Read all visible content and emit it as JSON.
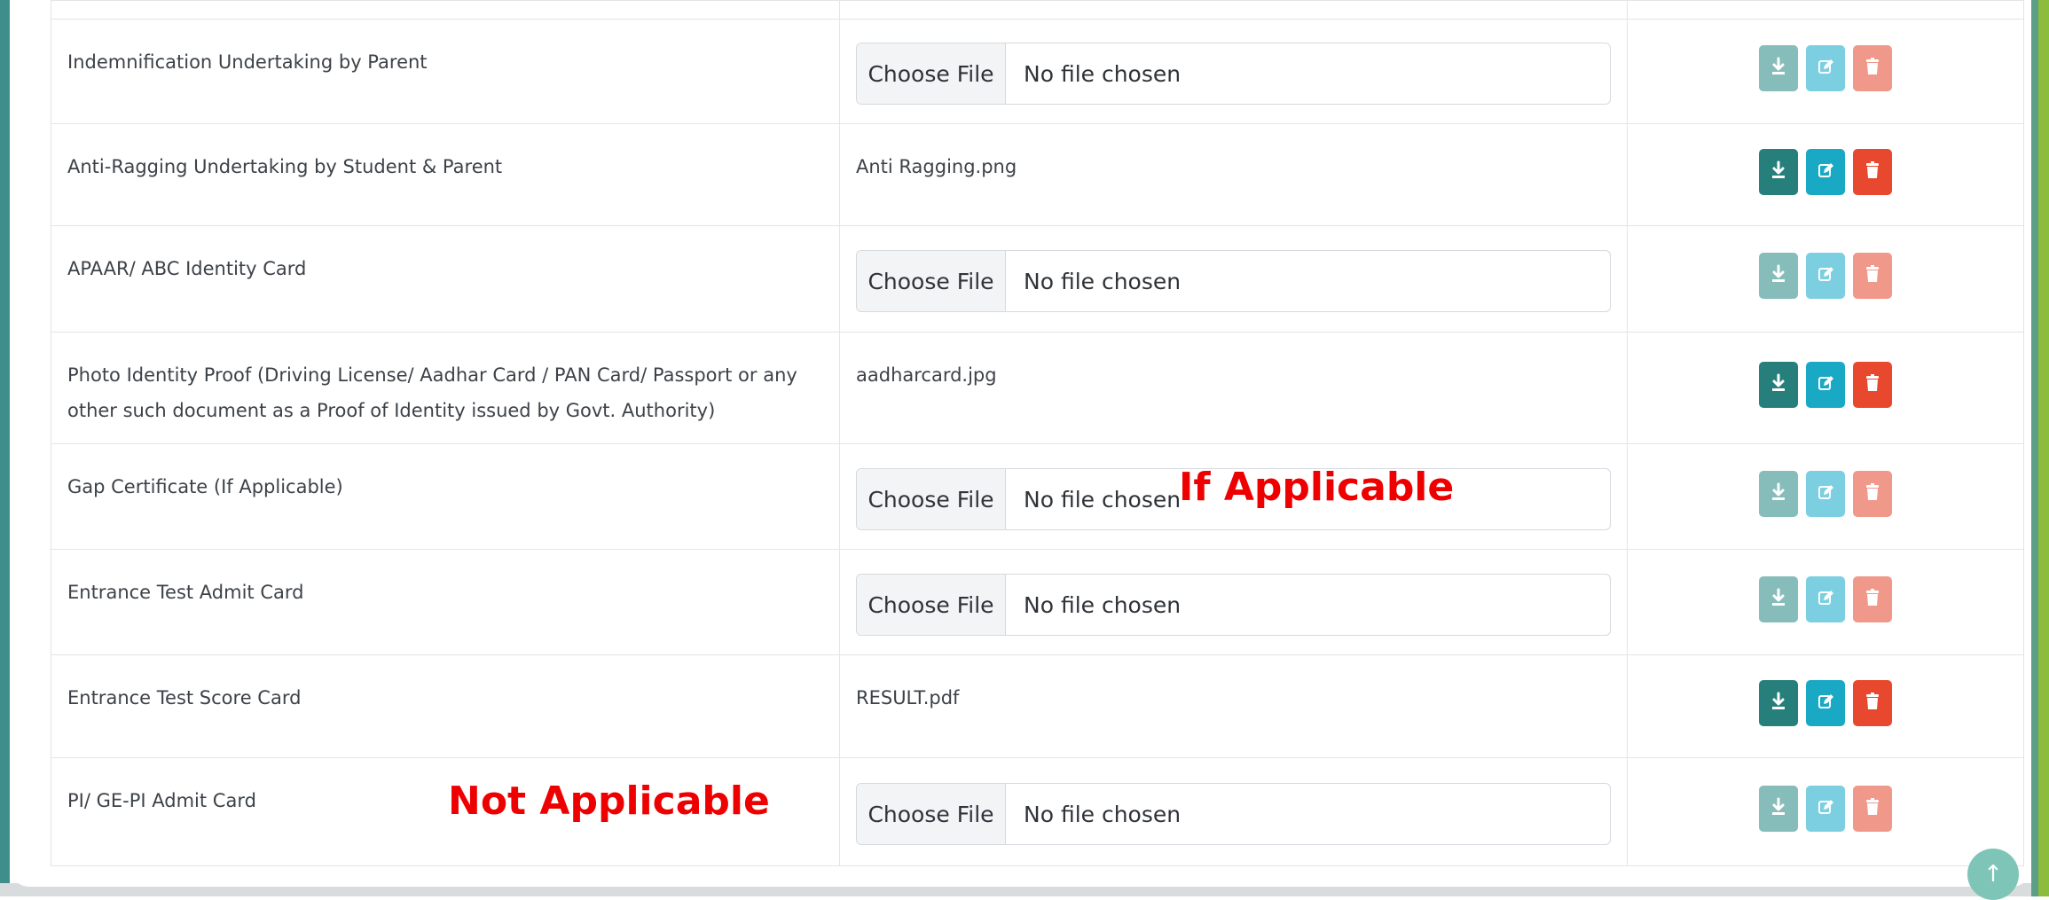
{
  "file_input": {
    "choose_label": "Choose File",
    "empty_label": "No file chosen"
  },
  "rows": [
    {
      "name_lines": [
        "Indemnification Undertaking by Parent"
      ],
      "file": null,
      "active": false
    },
    {
      "name_lines": [
        "Anti-Ragging Undertaking by Student & Parent"
      ],
      "file": "Anti Ragging.png",
      "active": true
    },
    {
      "name_lines": [
        "APAAR/ ABC Identity Card"
      ],
      "file": null,
      "active": false
    },
    {
      "name_lines": [
        "Photo Identity Proof (Driving License/ Aadhar Card / PAN Card/ Passport or any",
        "other such document as a Proof of Identity issued by Govt. Authority)"
      ],
      "file": "aadharcard.jpg",
      "active": true
    },
    {
      "name_lines": [
        "Gap Certificate (If Applicable)"
      ],
      "file": null,
      "active": false
    },
    {
      "name_lines": [
        "Entrance Test Admit Card"
      ],
      "file": null,
      "active": false
    },
    {
      "name_lines": [
        "Entrance Test Score Card"
      ],
      "file": "RESULT.pdf",
      "active": true
    },
    {
      "name_lines": [
        "PI/ GE-PI Admit Card"
      ],
      "file": null,
      "active": false
    }
  ],
  "annotations": {
    "if_applicable": "If Applicable",
    "not_applicable": "Not Applicable"
  },
  "icons": {
    "download": "download-icon",
    "edit": "edit-icon",
    "delete": "trash-icon",
    "scroll_top": "arrow-up-icon"
  },
  "colors": {
    "download_btn": "#277f7b",
    "edit_btn": "#1aa9c4",
    "delete_btn": "#e8482d",
    "annotation_red": "#ee0000"
  }
}
